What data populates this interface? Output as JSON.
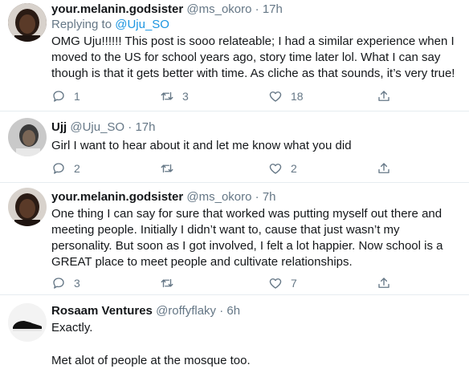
{
  "colors": {
    "link": "#1b95e0",
    "secondary": "#657786",
    "text": "#14171a"
  },
  "tweets": [
    {
      "name": "your.melanin.godsister",
      "handle": "@ms_okoro",
      "dot": "·",
      "time": "17h",
      "replying_prefix": "Replying to",
      "replying_to": "@Uju_SO",
      "lines": [
        "OMG Uju!!!!!! This post is sooo relateable; I had a similar experience when I",
        "moved to the US for school years ago, story time later lol. What I can say",
        "though is that it gets better with time. As cliche as that sounds, it’s very true!"
      ],
      "replies": "1",
      "retweets": "3",
      "likes": "18",
      "avatar_icon": "user-avatar"
    },
    {
      "name": "Ujj",
      "handle": "@Uju_SO",
      "dot": "·",
      "time": "17h",
      "lines": [
        "Girl I want to hear about it and let me know what you did"
      ],
      "replies": "2",
      "retweets": "",
      "likes": "2",
      "avatar_icon": "user-avatar"
    },
    {
      "name": "your.melanin.godsister",
      "handle": "@ms_okoro",
      "dot": "·",
      "time": "7h",
      "lines": [
        "One thing I can say for sure that worked was putting myself out there and",
        "meeting people. Initially I didn’t want to, cause that just wasn’t my",
        "personality. But soon as I got involved, I felt a lot happier. Now school is a",
        "GREAT place to meet people and cultivate relationships."
      ],
      "replies": "3",
      "retweets": "",
      "likes": "7",
      "avatar_icon": "user-avatar"
    },
    {
      "name": "Rosaam Ventures",
      "handle": "@roffyflaky",
      "dot": "·",
      "time": "6h",
      "lines": [
        "Exactly.",
        "",
        "Met alot of people at the mosque too."
      ],
      "avatar_icon": "shoe-avatar"
    }
  ]
}
